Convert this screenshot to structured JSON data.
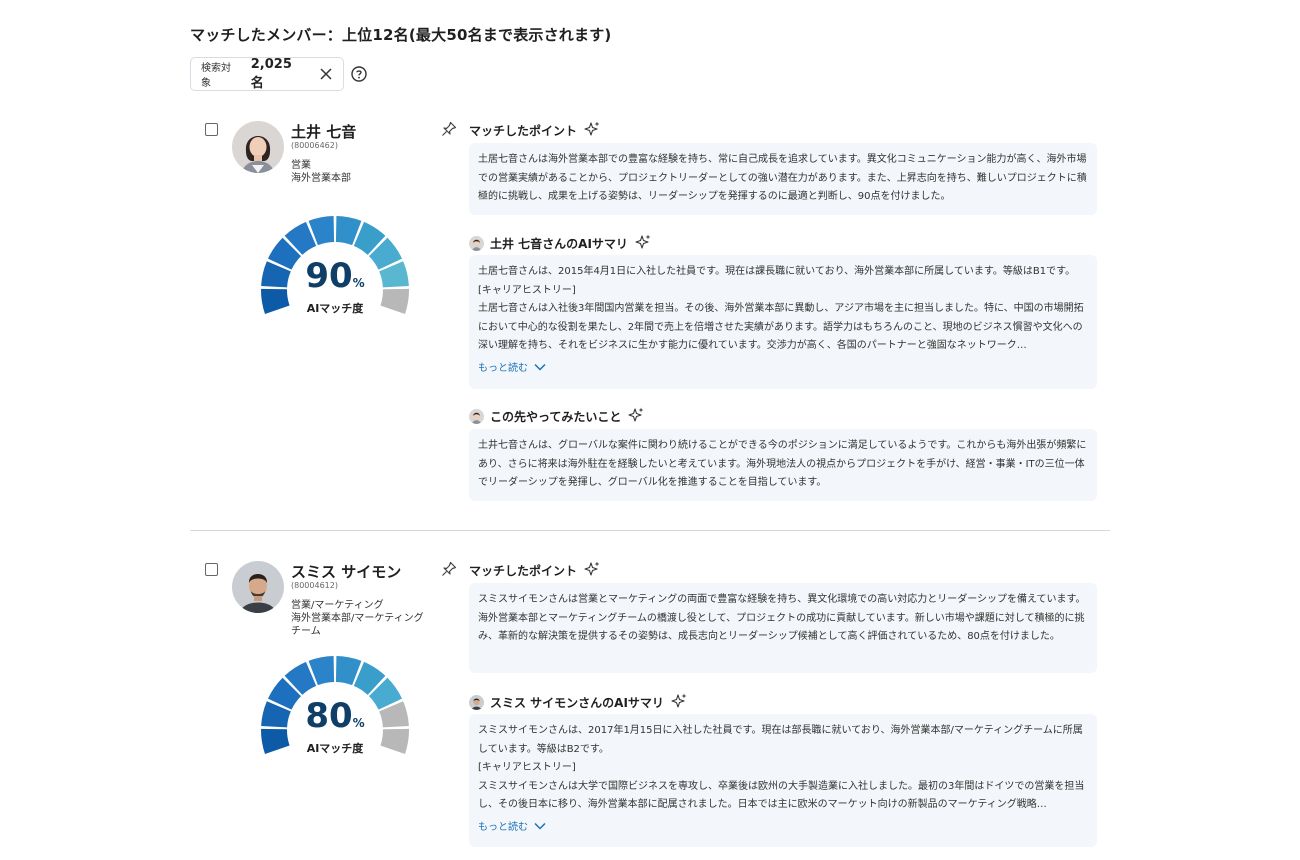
{
  "header": {
    "title": "マッチしたメンバー：上位12名(最大50名まで表示されます)",
    "filter_label": "検索対象",
    "filter_count": "2,025 名"
  },
  "members": [
    {
      "name": "土井 七音",
      "id": "(80006462)",
      "role": "営業",
      "dept": "海外営業本部",
      "score": "90",
      "score_unit": "%",
      "score_label": "AIマッチ度",
      "score_value": 90,
      "match_title": "マッチしたポイント",
      "match_text": "土居七音さんは海外営業本部での豊富な経験を持ち、常に自己成長を追求しています。異文化コミュニケーション能力が高く、海外市場での営業実績があることから、プロジェクトリーダーとしての強い潜在力があります。また、上昇志向を持ち、難しいプロジェクトに積極的に挑戦し、成果を上げる姿勢は、リーダーシップを発揮するのに最適と判断し、90点を付けました。",
      "summary_title": "土井 七音さんのAIサマリ",
      "summary_lines": [
        "土居七音さんは、2015年4月1日に入社した社員です。現在は課長職に就いており、海外営業本部に所属しています。等級はB1です。",
        "[キャリアヒストリー]",
        "土居七音さんは入社後3年間国内営業を担当。その後、海外営業本部に異動し、アジア市場を主に担当しました。特に、中国の市場開拓において中心的な役割を果たし、2年間で売上を倍増させた実績があります。語学力はもちろんのこと、現地のビジネス慣習や文化への深い理解を持ち、それをビジネスに生かす能力に優れています。交渉力が高く、各国のパートナーと強固なネットワーク…"
      ],
      "more_label": "もっと読む",
      "future_title": "この先やってみたいこと",
      "future_text": "土井七音さんは、グローバルな案件に関わり続けることができる今のポジションに満足しているようです。これからも海外出張が頻繁にあり、さらに将来は海外駐在を経験したいと考えています。海外現地法人の視点からプロジェクトを手がけ、経営・事業・ITの三位一体でリーダーシップを発揮し、グローバル化を推進することを目指しています。"
    },
    {
      "name": "スミス サイモン",
      "id": "(80004612)",
      "role": "営業/マーケティング",
      "dept": "海外営業本部/マーケティングチーム",
      "score": "80",
      "score_unit": "%",
      "score_label": "AIマッチ度",
      "score_value": 80,
      "match_title": "マッチしたポイント",
      "match_text": "スミスサイモンさんは営業とマーケティングの両面で豊富な経験を持ち、異文化環境での高い対応力とリーダーシップを備えています。海外営業本部とマーケティングチームの橋渡し役として、プロジェクトの成功に貢献しています。新しい市場や課題に対して積極的に挑み、革新的な解決策を提供するその姿勢は、成長志向とリーダーシップ候補として高く評価されているため、80点を付けました。",
      "summary_title": "スミス サイモンさんのAIサマリ",
      "summary_lines": [
        "スミスサイモンさんは、2017年1月15日に入社した社員です。現在は部長職に就いており、海外営業本部/マーケティングチームに所属しています。等級はB2です。",
        "[キャリアヒストリー]",
        "スミスサイモンさんは大学で国際ビジネスを専攻し、卒業後は欧州の大手製造業に入社しました。最初の3年間はドイツでの営業を担当し、その後日本に移り、海外営業本部に配属されました。日本では主に欧米のマーケット向けの新製品のマーケティング戦略…"
      ],
      "more_label": "もっと読む"
    }
  ],
  "colors": {
    "gauge_blues": [
      "#0d5aa7",
      "#1565b3",
      "#1d70bd",
      "#2579c4",
      "#2b84c9",
      "#3190ca",
      "#3a9ecb",
      "#48abcf",
      "#5ab7d0",
      "#6cc1d1",
      "#b8b8b8"
    ],
    "box_bg": "#f3f6fa",
    "link": "#1a73b8"
  },
  "icons": [
    "close-icon",
    "help-icon",
    "pin-icon",
    "sparkle-icon",
    "chevron-down-icon"
  ]
}
